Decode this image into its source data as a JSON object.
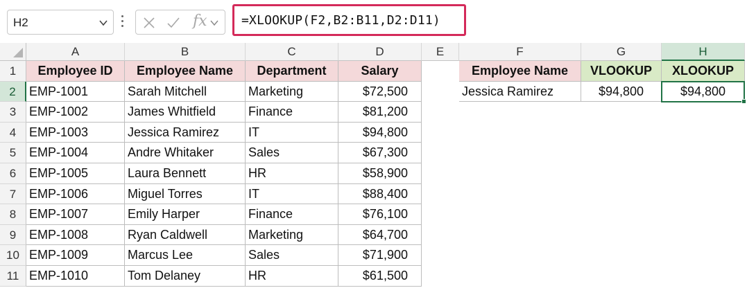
{
  "formula_bar": {
    "name_box": "H2",
    "formula": "=XLOOKUP(F2,B2:B11,D2:D11)",
    "icons": [
      "chevron-down-icon",
      "more-options-icon",
      "cancel-icon",
      "enter-check-icon",
      "insert-function-icon",
      "expand-icon"
    ],
    "highlight_color": "#d42a5a"
  },
  "columns": [
    "A",
    "B",
    "C",
    "D",
    "E",
    "F",
    "G",
    "H"
  ],
  "active_column": "H",
  "rows": [
    "1",
    "2",
    "3",
    "4",
    "5",
    "6",
    "7",
    "8",
    "9",
    "10",
    "11"
  ],
  "active_row": "2",
  "employees": {
    "headers": [
      "Employee ID",
      "Employee Name",
      "Department",
      "Salary"
    ],
    "header_color": "#f4d9da",
    "records": [
      [
        "EMP-1001",
        "Sarah Mitchell",
        "Marketing",
        "$72,500"
      ],
      [
        "EMP-1002",
        "James Whitfield",
        "Finance",
        "$81,200"
      ],
      [
        "EMP-1003",
        "Jessica Ramirez",
        "IT",
        "$94,800"
      ],
      [
        "EMP-1004",
        "Andre Whitaker",
        "Sales",
        "$67,300"
      ],
      [
        "EMP-1005",
        "Laura Bennett",
        "HR",
        "$58,900"
      ],
      [
        "EMP-1006",
        "Miguel Torres",
        "IT",
        "$88,400"
      ],
      [
        "EMP-1007",
        "Emily Harper",
        "Finance",
        "$76,100"
      ],
      [
        "EMP-1008",
        "Ryan Caldwell",
        "Marketing",
        "$64,700"
      ],
      [
        "EMP-1009",
        "Marcus Lee",
        "Sales",
        "$71,900"
      ],
      [
        "EMP-1010",
        "Tom Delaney",
        "HR",
        "$61,500"
      ]
    ]
  },
  "lookup": {
    "headers": [
      "Employee Name",
      "VLOOKUP",
      "XLOOKUP"
    ],
    "header_colors": [
      "#f4d9da",
      "#d9eac6",
      "#d9eac6"
    ],
    "values": [
      "Jessica Ramirez",
      "$94,800",
      "$94,800"
    ]
  },
  "selection_color": "#217346"
}
